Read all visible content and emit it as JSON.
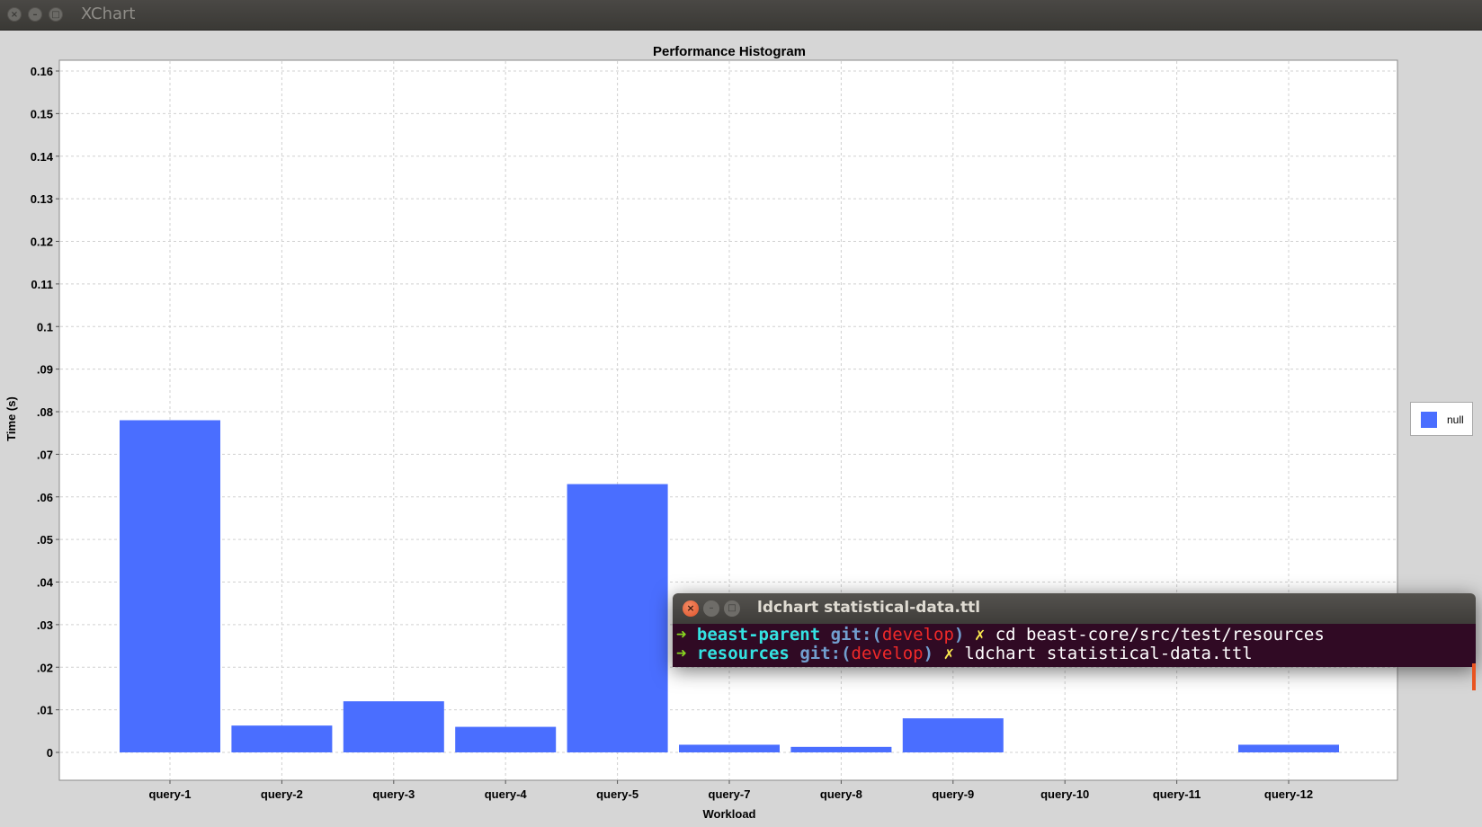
{
  "window": {
    "title": "XChart",
    "controls": [
      "close",
      "minimize",
      "maximize"
    ]
  },
  "chart_data": {
    "type": "bar",
    "title": "Performance Histogram",
    "xlabel": "Workload",
    "ylabel": "Time (s)",
    "categories": [
      "query-1",
      "query-2",
      "query-3",
      "query-4",
      "query-5",
      "query-7",
      "query-8",
      "query-9",
      "query-10",
      "query-11",
      "query-12"
    ],
    "series": [
      {
        "name": "null",
        "values": [
          0.078,
          0.0063,
          0.012,
          0.006,
          0.063,
          0.0018,
          0.0013,
          0.008,
          0,
          0,
          0.0018
        ]
      }
    ],
    "ylim": [
      0,
      0.16
    ],
    "yticks": [
      {
        "value": 0,
        "label": "0"
      },
      {
        "value": 0.01,
        "label": ".01"
      },
      {
        "value": 0.02,
        "label": ".02"
      },
      {
        "value": 0.03,
        "label": ".03"
      },
      {
        "value": 0.04,
        "label": ".04"
      },
      {
        "value": 0.05,
        "label": ".05"
      },
      {
        "value": 0.06,
        "label": ".06"
      },
      {
        "value": 0.07,
        "label": ".07"
      },
      {
        "value": 0.08,
        "label": ".08"
      },
      {
        "value": 0.09,
        "label": ".09"
      },
      {
        "value": 0.1,
        "label": "0.1"
      },
      {
        "value": 0.11,
        "label": "0.11"
      },
      {
        "value": 0.12,
        "label": "0.12"
      },
      {
        "value": 0.13,
        "label": "0.13"
      },
      {
        "value": 0.14,
        "label": "0.14"
      },
      {
        "value": 0.15,
        "label": "0.15"
      },
      {
        "value": 0.16,
        "label": "0.16"
      }
    ],
    "grid": true,
    "legend_position": "right",
    "bar_color": "#4a6eff"
  },
  "legend": {
    "label": "null"
  },
  "terminal": {
    "title": "ldchart statistical-data.ttl",
    "lines": [
      {
        "arrow": "➜",
        "dir": "beast-parent",
        "git": "git:(",
        "branch": "develop",
        "git_close": ")",
        "dirty": "✗",
        "command": "cd beast-core/src/test/resources"
      },
      {
        "arrow": "➜",
        "dir": "resources",
        "git": "git:(",
        "branch": "develop",
        "git_close": ")",
        "dirty": "✗",
        "command": "ldchart statistical-data.ttl"
      }
    ]
  },
  "colors": {
    "bar": "#4a6eff",
    "terminal_bg": "#300a24",
    "chart_bg": "#d6d6d6",
    "plot_bg": "#ffffff"
  }
}
